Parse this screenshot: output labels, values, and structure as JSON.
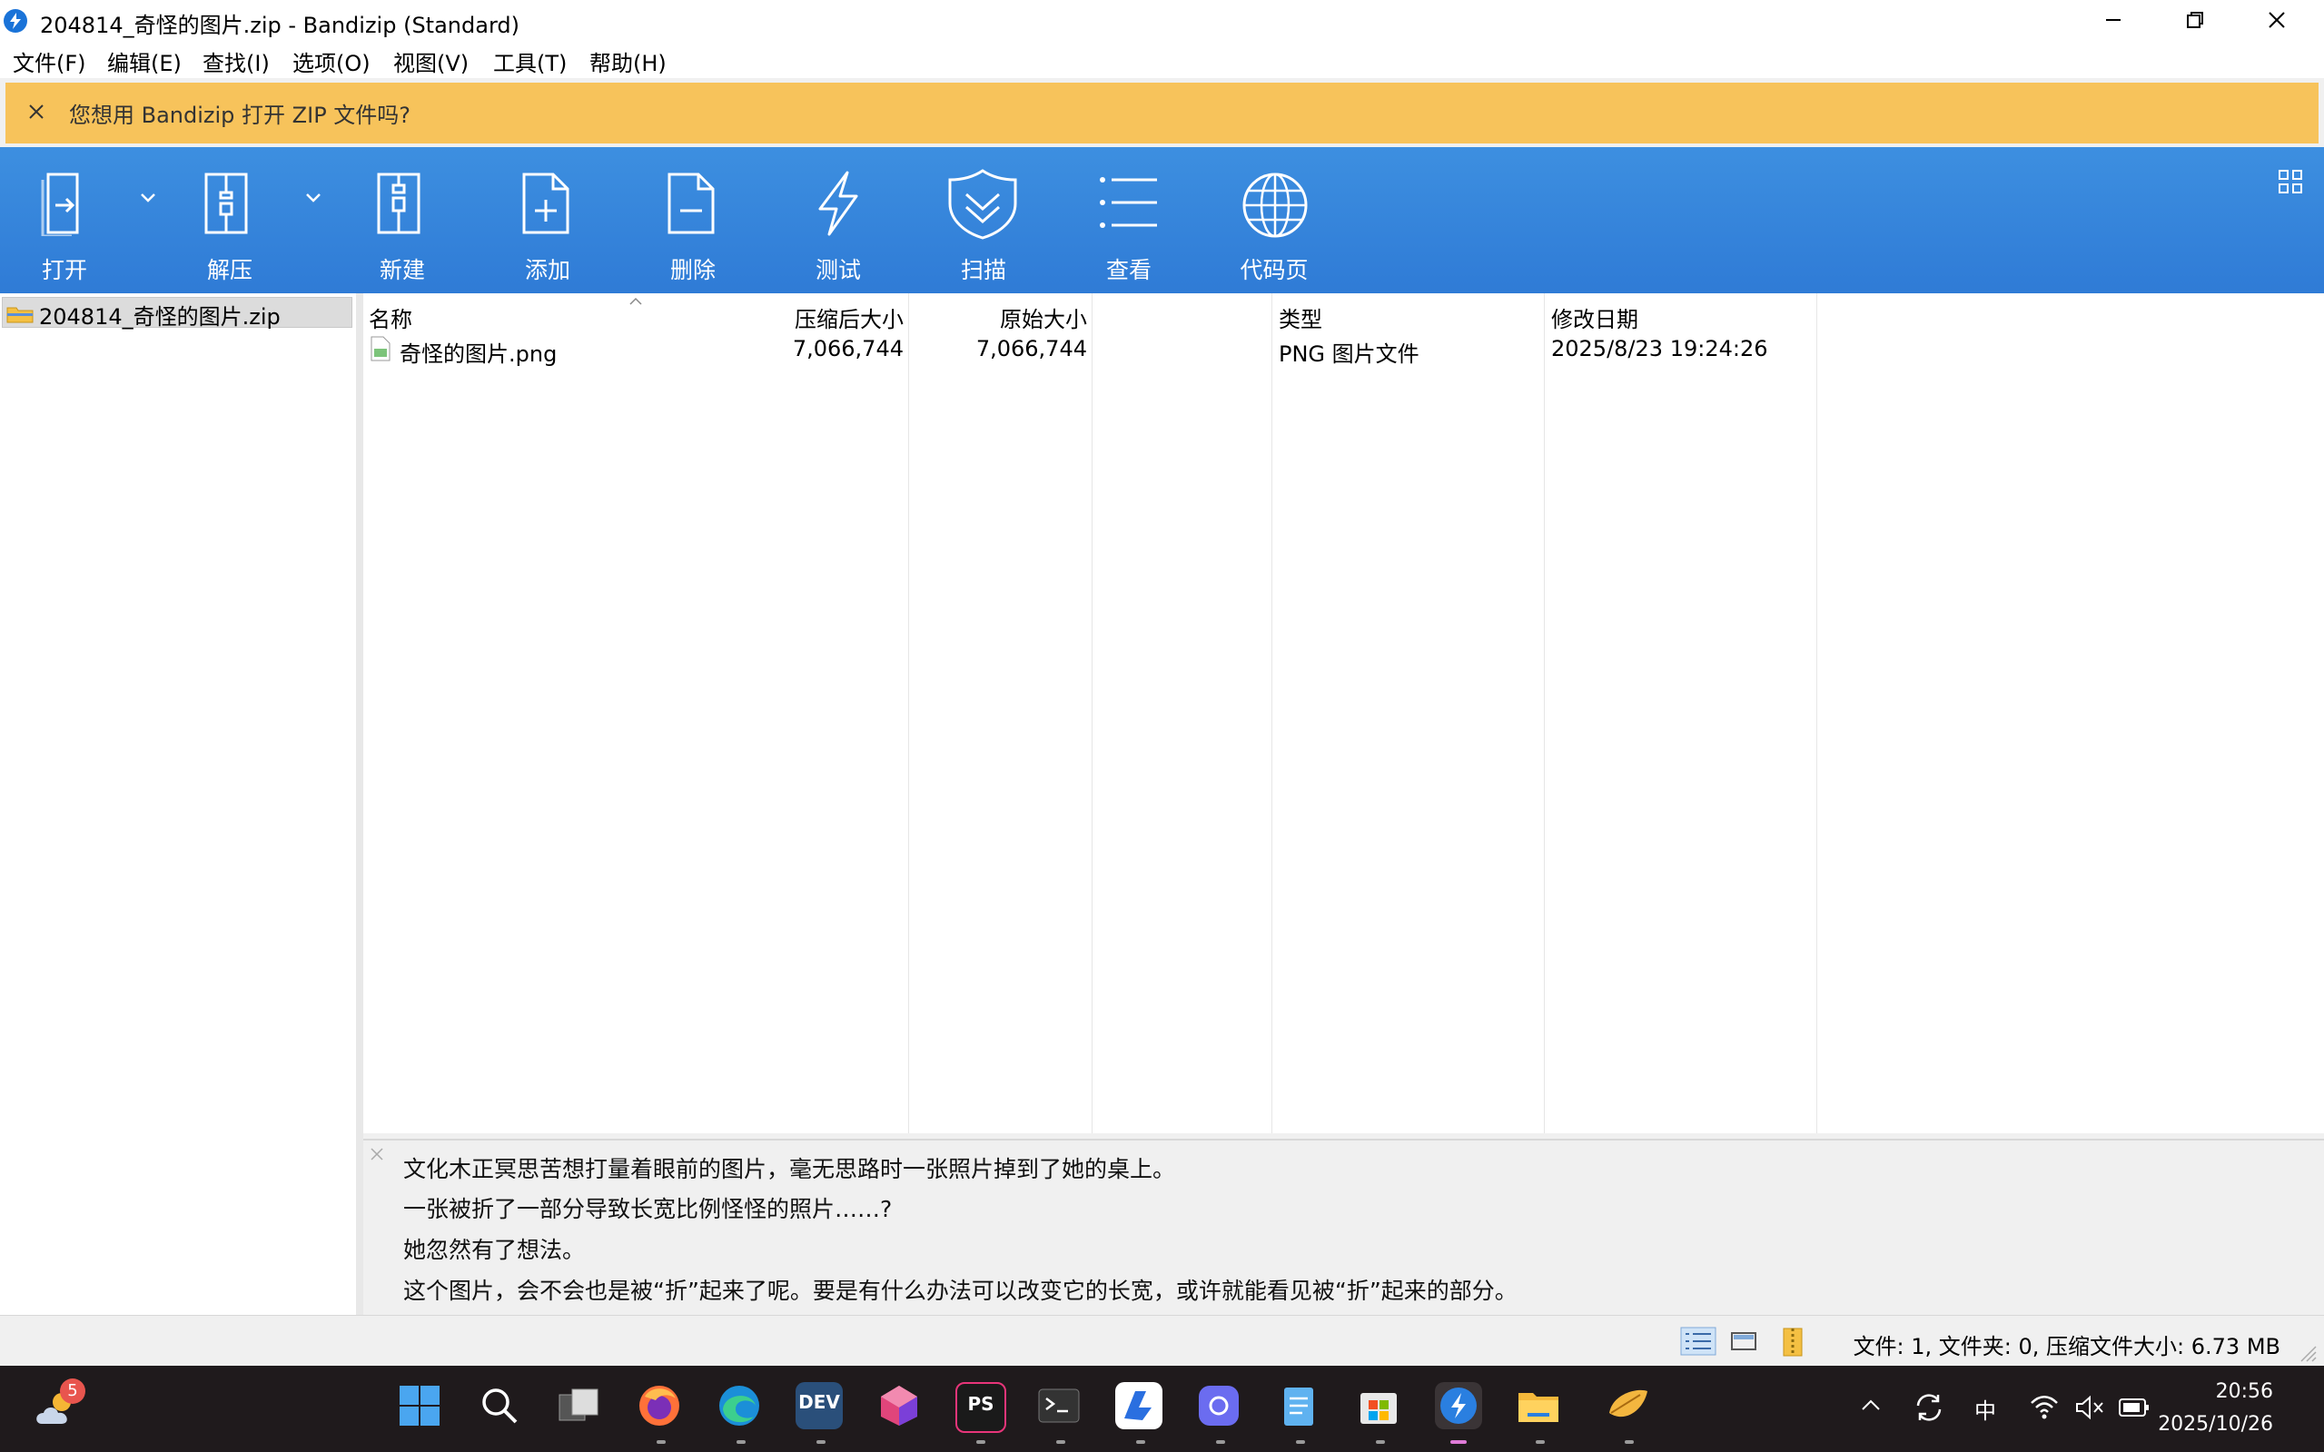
{
  "window": {
    "title": "204814_奇怪的图片.zip - Bandizip (Standard)"
  },
  "menu": [
    {
      "label": "文件(F)"
    },
    {
      "label": "编辑(E)"
    },
    {
      "label": "查找(I)"
    },
    {
      "label": "选项(O)"
    },
    {
      "label": "视图(V)"
    },
    {
      "label": "工具(T)"
    },
    {
      "label": "帮助(H)"
    }
  ],
  "notify": {
    "text": "您想用 Bandizip 打开 ZIP 文件吗?",
    "color": "#f7c35b"
  },
  "toolbar": {
    "color": "#3d8fe0",
    "tools": [
      {
        "label": "打开",
        "icon": "open-icon"
      },
      {
        "label": "解压",
        "icon": "extract-icon"
      },
      {
        "label": "新建",
        "icon": "new-archive-icon"
      },
      {
        "label": "添加",
        "icon": "add-file-icon"
      },
      {
        "label": "删除",
        "icon": "delete-file-icon"
      },
      {
        "label": "测试",
        "icon": "lightning-icon"
      },
      {
        "label": "扫描",
        "icon": "shield-icon"
      },
      {
        "label": "查看",
        "icon": "list-icon"
      },
      {
        "label": "代码页",
        "icon": "globe-icon"
      }
    ]
  },
  "tree": {
    "item": "204814_奇怪的图片.zip"
  },
  "list": {
    "columns": [
      "名称",
      "压缩后大小",
      "原始大小",
      "类型",
      "修改日期"
    ],
    "rows": [
      {
        "name": "奇怪的图片.png",
        "compressed": "7,066,744",
        "original": "7,066,744",
        "type": "PNG 图片文件",
        "modified": "2025/8/23 19:24:26"
      }
    ]
  },
  "comment": {
    "lines": [
      "文化木正冥思苦想打量着眼前的图片，毫无思路时一张照片掉到了她的桌上。",
      "一张被折了一部分导致长宽比例怪怪的照片……?",
      "她忽然有了想法。",
      "这个图片，会不会也是被“折”起来了呢。要是有什么办法可以改变它的长宽，或许就能看见被“折”起来的部分。"
    ]
  },
  "status": {
    "text": "文件: 1, 文件夹: 0, 压缩文件大小: 6.73 MB"
  },
  "taskbar": {
    "weather_badge": "5",
    "apps": [
      {
        "icon": "start-icon"
      },
      {
        "icon": "search-icon"
      },
      {
        "icon": "task-view-icon"
      },
      {
        "icon": "firefox-icon"
      },
      {
        "icon": "edge-icon"
      },
      {
        "icon": "devcpp-icon",
        "label": "DEV"
      },
      {
        "icon": "cube-app-icon"
      },
      {
        "icon": "phpstorm-icon",
        "label": "PS"
      },
      {
        "icon": "terminal-icon"
      },
      {
        "icon": "baidu-netdisk-icon"
      },
      {
        "icon": "copilot-icon"
      },
      {
        "icon": "notepad-icon"
      },
      {
        "icon": "ms-store-icon"
      },
      {
        "icon": "bandizip-icon"
      },
      {
        "icon": "file-explorer-icon"
      },
      {
        "icon": "leaf-app-icon"
      }
    ],
    "tray": {
      "ime": "中",
      "time": "20:56",
      "date": "2025/10/26"
    }
  }
}
